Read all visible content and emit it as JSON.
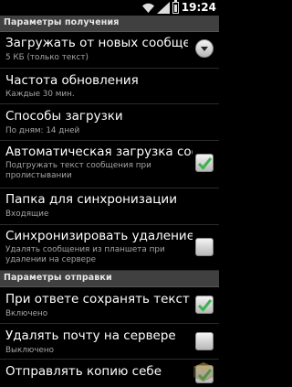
{
  "status_bar": {
    "time": "19:24",
    "icons": [
      "wifi-icon",
      "signal-icon",
      "battery-icon"
    ]
  },
  "sections": {
    "receive": {
      "title": "Параметры получения"
    },
    "send": {
      "title": "Параметры отправки"
    }
  },
  "receive_items": [
    {
      "title": "Загружать от новых сообщений",
      "subtitle": "5 КБ (только текст)",
      "control": "dropdown"
    },
    {
      "title": "Частота обновления",
      "subtitle": "Каждые 30 мин."
    },
    {
      "title": "Способы загрузки",
      "subtitle": "По дням: 14 дней"
    },
    {
      "title": "Автоматическая загрузка сообщ",
      "subtitle_lines": [
        "Подгружать текст сообщения при",
        "пролистывании"
      ],
      "checked": true
    },
    {
      "title": "Папка для синхронизации",
      "subtitle": "Входящие"
    },
    {
      "title": "Синхронизировать удаление эл",
      "subtitle_lines": [
        "Удалять сообщения из планшета при",
        "удалении на сервере"
      ],
      "checked": false
    }
  ],
  "send_items": [
    {
      "title": "При ответе сохранять текст исх",
      "subtitle": "Включено",
      "checked": true
    },
    {
      "title": "Удалять почту на сервере",
      "subtitle": "Выключено",
      "checked": false
    },
    {
      "title": "Отправлять копию себе",
      "subtitle": "",
      "checked": true
    }
  ],
  "colors": {
    "background": "#000000",
    "section_header": "#404040",
    "subtitle": "#a5a5a5",
    "check": "#3fb34f"
  }
}
